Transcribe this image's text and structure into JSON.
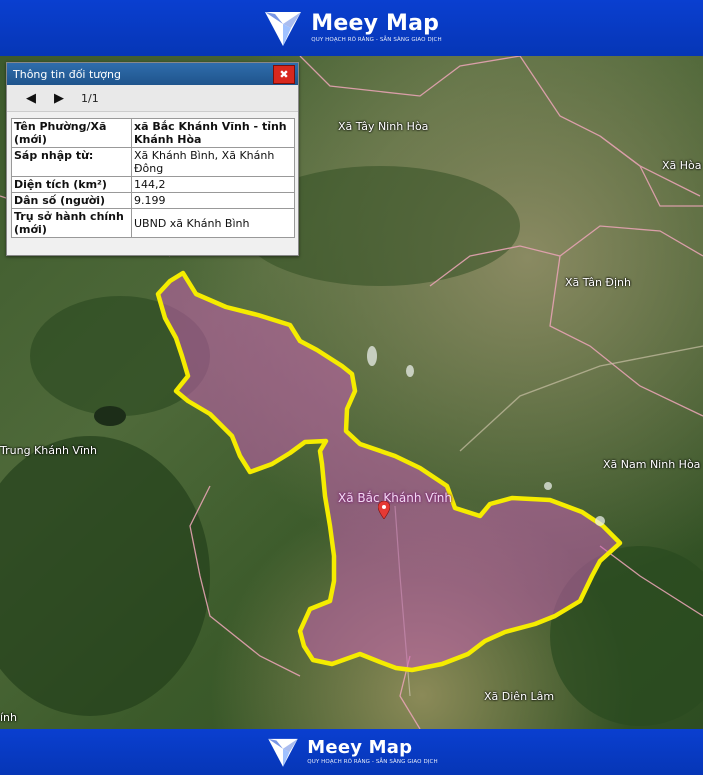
{
  "brand": {
    "name": "Meey Map",
    "tagline": "QUY HOẠCH RÕ RÀNG - SẴN SÀNG GIAO DỊCH",
    "primary_color": "#0a3fd0"
  },
  "info_panel": {
    "title": "Thông tin đối tượng",
    "close_icon": "close-icon",
    "pagination": "1/1",
    "rows": [
      {
        "label": "Tên Phường/Xã (mới)",
        "value": "xã Bắc Khánh Vĩnh - tỉnh Khánh Hòa"
      },
      {
        "label": "Sáp nhập từ:",
        "value": "Xã Khánh Bình, Xã Khánh Đông"
      },
      {
        "label": "Diện tích (km²)",
        "value": "144,2"
      },
      {
        "label": "Dân số (người)",
        "value": "9.199"
      },
      {
        "label": "Trụ sở hành chính (mới)",
        "value": "UBND xã Khánh Bình"
      }
    ]
  },
  "map": {
    "highlight_color": "#f5ec00",
    "fill_color": "#c85fb4",
    "labels": {
      "tay_ninh_hoa": "Xã Tây Ninh Hòa",
      "ninh_hoa": "Xã Hòa",
      "tan_dinh": "Xã Tân Định",
      "nam_ninh_hoa": "Xã Nam Ninh Hòa",
      "trung_khanh_vinh": "Trung Khánh Vĩnh",
      "bac_khanh_vinh": "Xã Bắc Khánh Vĩnh",
      "dien_lam": "Xã Diên Lâm",
      "left_edge": "ính"
    }
  }
}
